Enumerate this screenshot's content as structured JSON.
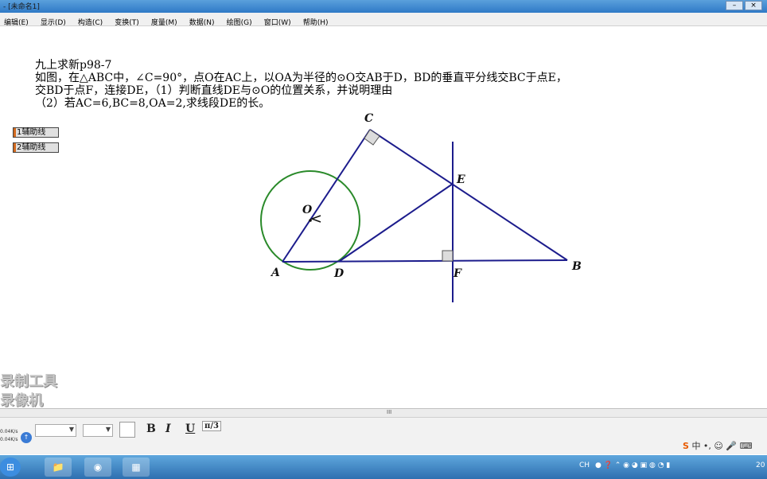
{
  "window": {
    "title": "- [未命名1]",
    "min_icon": "minimize-icon",
    "close_icon": "close-icon"
  },
  "menu": [
    "编辑(E)",
    "显示(D)",
    "构造(C)",
    "变换(T)",
    "度量(M)",
    "数据(N)",
    "绘图(G)",
    "窗口(W)",
    "帮助(H)"
  ],
  "problem": {
    "lines": [
      "九上求新p98-7",
      "如图，在△ABC中，∠C=90°，点O在AC上，以OA为半径的⊙O交AB于D，BD的垂直平分线交BC于点E，",
      "交BD于点F，连接DE，（1）判断直线DE与⊙O的位置关系，并说明理由",
      "（2）若AC=6,BC=8,OA=2,求线段DE的长。"
    ]
  },
  "aux_buttons": [
    "1辅助线",
    "2辅助线"
  ],
  "diagram": {
    "labels": {
      "C": "C",
      "E": "E",
      "O": "O",
      "A": "A",
      "D": "D",
      "F": "F",
      "B": "B"
    },
    "colors": {
      "triangle": "#1c1c8c",
      "circle": "#2a8a2a",
      "marker": "#666666"
    }
  },
  "watermark": [
    "录制工具",
    "录像机"
  ],
  "scrollbar": {
    "grip": "III"
  },
  "format_bar": {
    "bold": "B",
    "italic": "I",
    "underline": "U",
    "fraction": "π/3"
  },
  "net_speed": [
    "0.04K/s",
    "0.04K/s"
  ],
  "ime": {
    "s": "S",
    "text": "中 •, ☺ 🎤 ⌨"
  },
  "tray": {
    "lang": "CH",
    "clock": "20"
  }
}
